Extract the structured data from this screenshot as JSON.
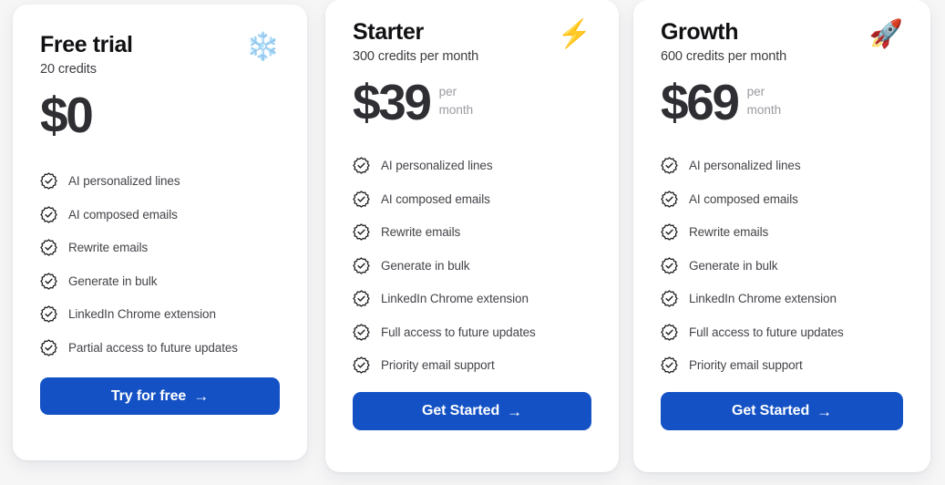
{
  "theme": {
    "page_background": "#f6f6f7",
    "card_background": "#ffffff",
    "accent_blue": "#1351c4",
    "price_color": "#2e2e33",
    "feature_text_color": "#44444a",
    "muted_text_color": "#9a9aa1"
  },
  "plans": [
    {
      "name": "Free trial",
      "credits": "20 credits",
      "price": "$0",
      "period": "",
      "emoji": "❄️",
      "emoji_name": "snowflake-icon",
      "cta_label": "Try for free",
      "cta_arrow": "→",
      "features": [
        "AI personalized lines",
        "AI composed emails",
        "Rewrite emails",
        "Generate in bulk",
        "LinkedIn Chrome extension",
        "Partial access to future updates"
      ]
    },
    {
      "name": "Starter",
      "credits": "300 credits per month",
      "price": "$39",
      "period": "per month",
      "emoji": "⚡",
      "emoji_name": "lightning-bolt-icon",
      "cta_label": "Get Started",
      "cta_arrow": "→",
      "features": [
        "AI personalized lines",
        "AI composed emails",
        "Rewrite emails",
        "Generate in bulk",
        "LinkedIn Chrome extension",
        "Full access to future updates",
        "Priority email support"
      ]
    },
    {
      "name": "Growth",
      "credits": "600 credits per month",
      "price": "$69",
      "period": "per month",
      "emoji": "🚀",
      "emoji_name": "rocket-icon",
      "cta_label": "Get Started",
      "cta_arrow": "→",
      "features": [
        "AI personalized lines",
        "AI composed emails",
        "Rewrite emails",
        "Generate in bulk",
        "LinkedIn Chrome extension",
        "Full access to future updates",
        "Priority email support"
      ]
    }
  ]
}
